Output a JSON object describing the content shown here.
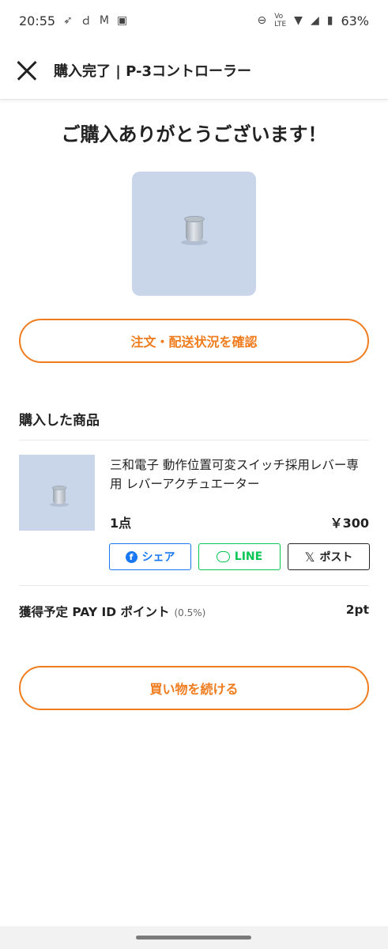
{
  "status_bar": {
    "time": "20:55",
    "battery": "63%",
    "icons": [
      "rocket-icon",
      "docomo-icon",
      "gmail-icon",
      "bus-icon",
      "dnd-icon",
      "volte-icon",
      "wifi-icon",
      "signal-icon",
      "battery-icon"
    ]
  },
  "app_bar": {
    "title": "購入完了 | P-3コントローラー"
  },
  "main": {
    "thanks_message": "ご購入ありがとうございます！",
    "order_status_button": "注文・配送状況を確認",
    "purchased_section_title": "購入した商品",
    "item": {
      "name": "三和電子 動作位置可変スイッチ採用レバー専用 レバーアクチュエーター",
      "quantity": "1点",
      "price": "￥300"
    },
    "share": {
      "facebook_label": "シェア",
      "line_label": "LINE",
      "x_label": "ポスト"
    },
    "points": {
      "label": "獲得予定 PAY ID ポイント",
      "rate": "(0.5%)",
      "value": "2pt"
    },
    "continue_button": "買い物を続ける"
  },
  "colors": {
    "accent": "#f07c1e",
    "facebook": "#1877f2",
    "line": "#06c755"
  }
}
